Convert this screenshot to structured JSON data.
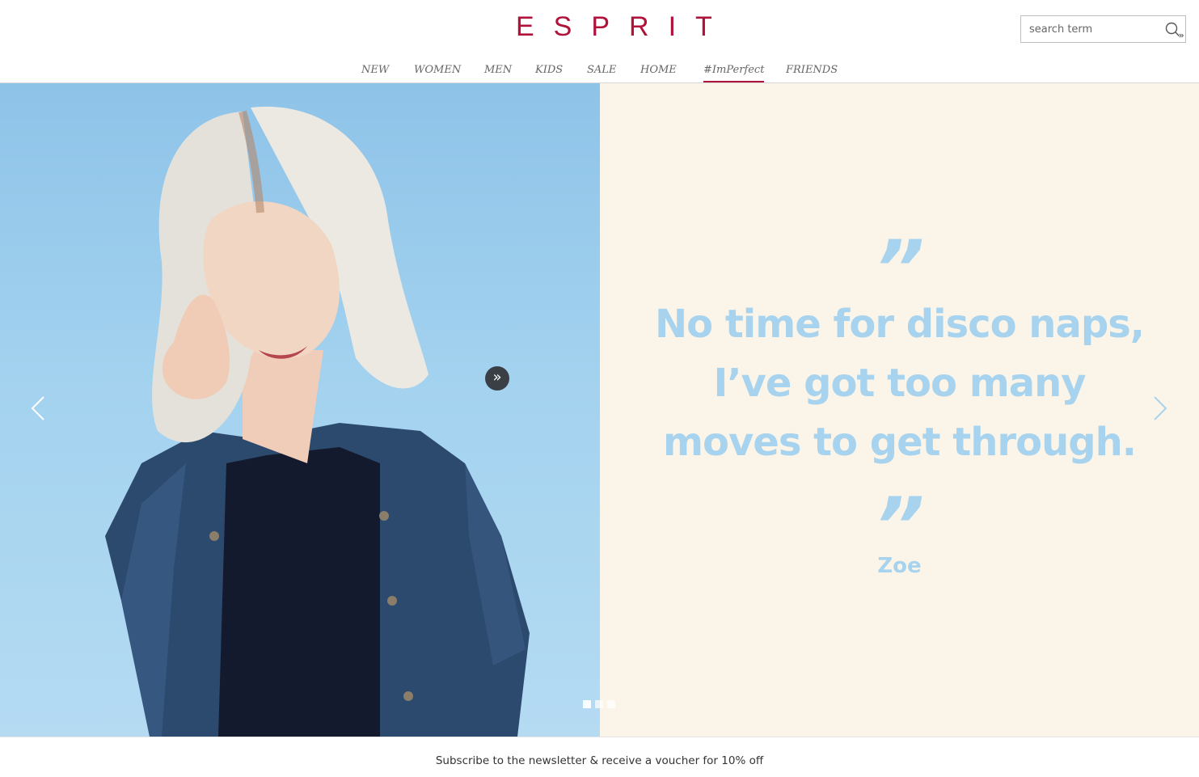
{
  "brand": {
    "logo_text": "ESPRIT",
    "color": "#b0123a"
  },
  "search": {
    "placeholder": "search term",
    "value": "",
    "icon": "search-icon"
  },
  "nav": {
    "items": [
      {
        "label": "NEW",
        "active": false
      },
      {
        "label": "WOMEN",
        "active": false
      },
      {
        "label": "MEN",
        "active": false
      },
      {
        "label": "KIDS",
        "active": false
      },
      {
        "label": "SALE",
        "active": false
      },
      {
        "label": "HOME",
        "active": false
      },
      {
        "label": "#ImPerfect",
        "active": true
      },
      {
        "label": "FRIENDS",
        "active": false
      }
    ]
  },
  "hero": {
    "quote_open": "”",
    "quote_lines": [
      "No time for disco naps,",
      "I’ve got too many",
      "moves to get through."
    ],
    "quote_close": "”",
    "author": "Zoe",
    "expand_label": "»",
    "prev_icon": "chevron-left-icon",
    "next_icon": "chevron-right-icon",
    "slide_count": 3,
    "active_slide": 1,
    "photo_background": "#a3d2ef",
    "panel_background": "#fbf5e9",
    "quote_color": "#a7d3ee"
  },
  "newsletter": {
    "text": "Subscribe to the newsletter & receive a voucher for 10% off"
  }
}
